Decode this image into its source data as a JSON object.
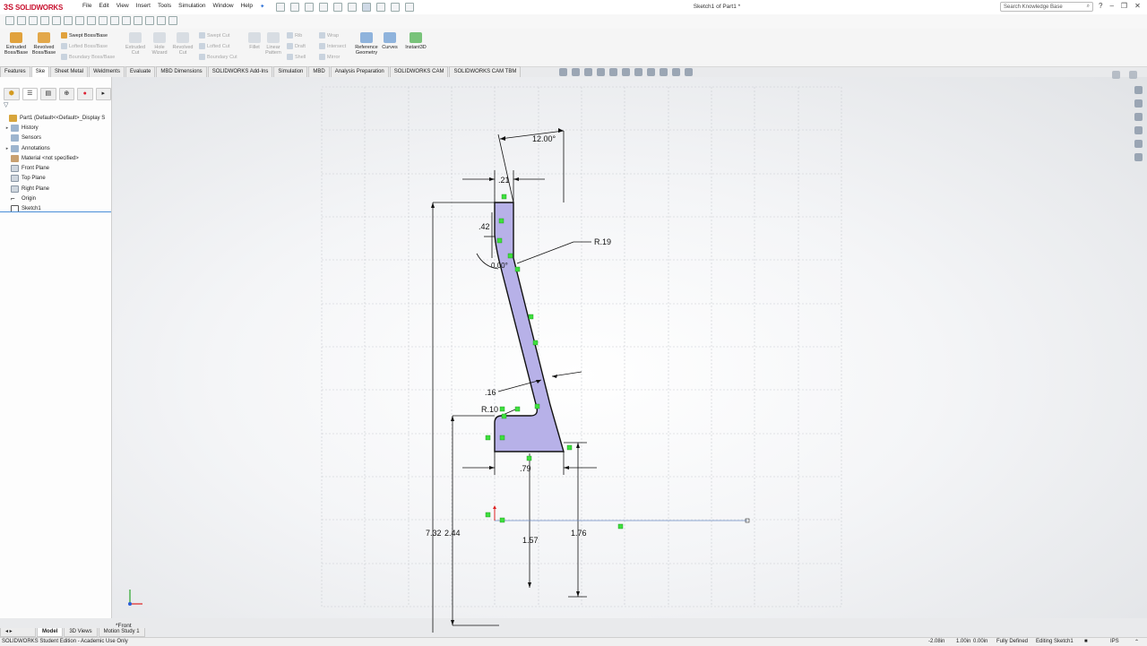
{
  "app": {
    "logo_ds": "3S",
    "logo_text": "SOLIDWORKS",
    "document_title": "Sketch1 of Part1 *",
    "menu": [
      "File",
      "Edit",
      "View",
      "Insert",
      "Tools",
      "Simulation",
      "Window",
      "Help"
    ],
    "search_placeholder": "Search Knowledge Base"
  },
  "command_manager": {
    "extruded_boss": "Extruded\nBoss/Base",
    "revolved_boss": "Revolved\nBoss/Base",
    "swept_boss": "Swept Boss/Base",
    "lofted_boss": "Lofted Boss/Base",
    "boundary_boss": "Boundary Boss/Base",
    "extruded_cut": "Extruded\nCut",
    "hole_wizard": "Hole\nWizard",
    "revolved_cut": "Revolved\nCut",
    "swept_cut": "Swept Cut",
    "lofted_cut": "Lofted Cut",
    "boundary_cut": "Boundary Cut",
    "fillet": "Fillet",
    "linear_pattern": "Linear\nPattern",
    "rib": "Rib",
    "draft": "Draft",
    "shell": "Shell",
    "wrap": "Wrap",
    "intersect": "Intersect",
    "mirror": "Mirror",
    "reference_geometry": "Reference\nGeometry",
    "curves": "Curves",
    "instant3d": "Instant3D"
  },
  "tabs": [
    "Features",
    "Ske",
    "Sheet Metal",
    "Weldments",
    "Evaluate",
    "MBD Dimensions",
    "SOLIDWORKS Add-Ins",
    "Simulation",
    "MBD",
    "Analysis Preparation",
    "SOLIDWORKS CAM",
    "SOLIDWORKS CAM TBM"
  ],
  "tree": {
    "root": "Part1  (Default<<Default>_Display S",
    "items": [
      "History",
      "Sensors",
      "Annotations",
      "Material <not specified>",
      "Front Plane",
      "Top Plane",
      "Right Plane",
      "Origin",
      "Sketch1"
    ]
  },
  "sketch": {
    "dims": {
      "top_width": "12.00°",
      "top_offset": ".21",
      "upper_height": ".42",
      "angle": "0.00°",
      "radius_top": "R.19",
      "thickness": ".16",
      "radius_bottom": "R.10",
      "base_width": ".79",
      "total_height": "7.32",
      "height_244": "2.44",
      "height_157": "1.57",
      "height_176": "1.76"
    },
    "fill_color": "#b7b1e8",
    "relation_color": "#3ee03e"
  },
  "view_label": "*Front",
  "bottom_tabs": [
    "Model",
    "3D Views",
    "Motion Study 1"
  ],
  "status": {
    "edition": "SOLIDWORKS Student Edition - Academic Use Only",
    "x": "-2.08in",
    "y": "1.00in",
    "z": "0.00in",
    "defined": "Fully Defined",
    "editing": "Editing Sketch1",
    "units": "IPS"
  }
}
